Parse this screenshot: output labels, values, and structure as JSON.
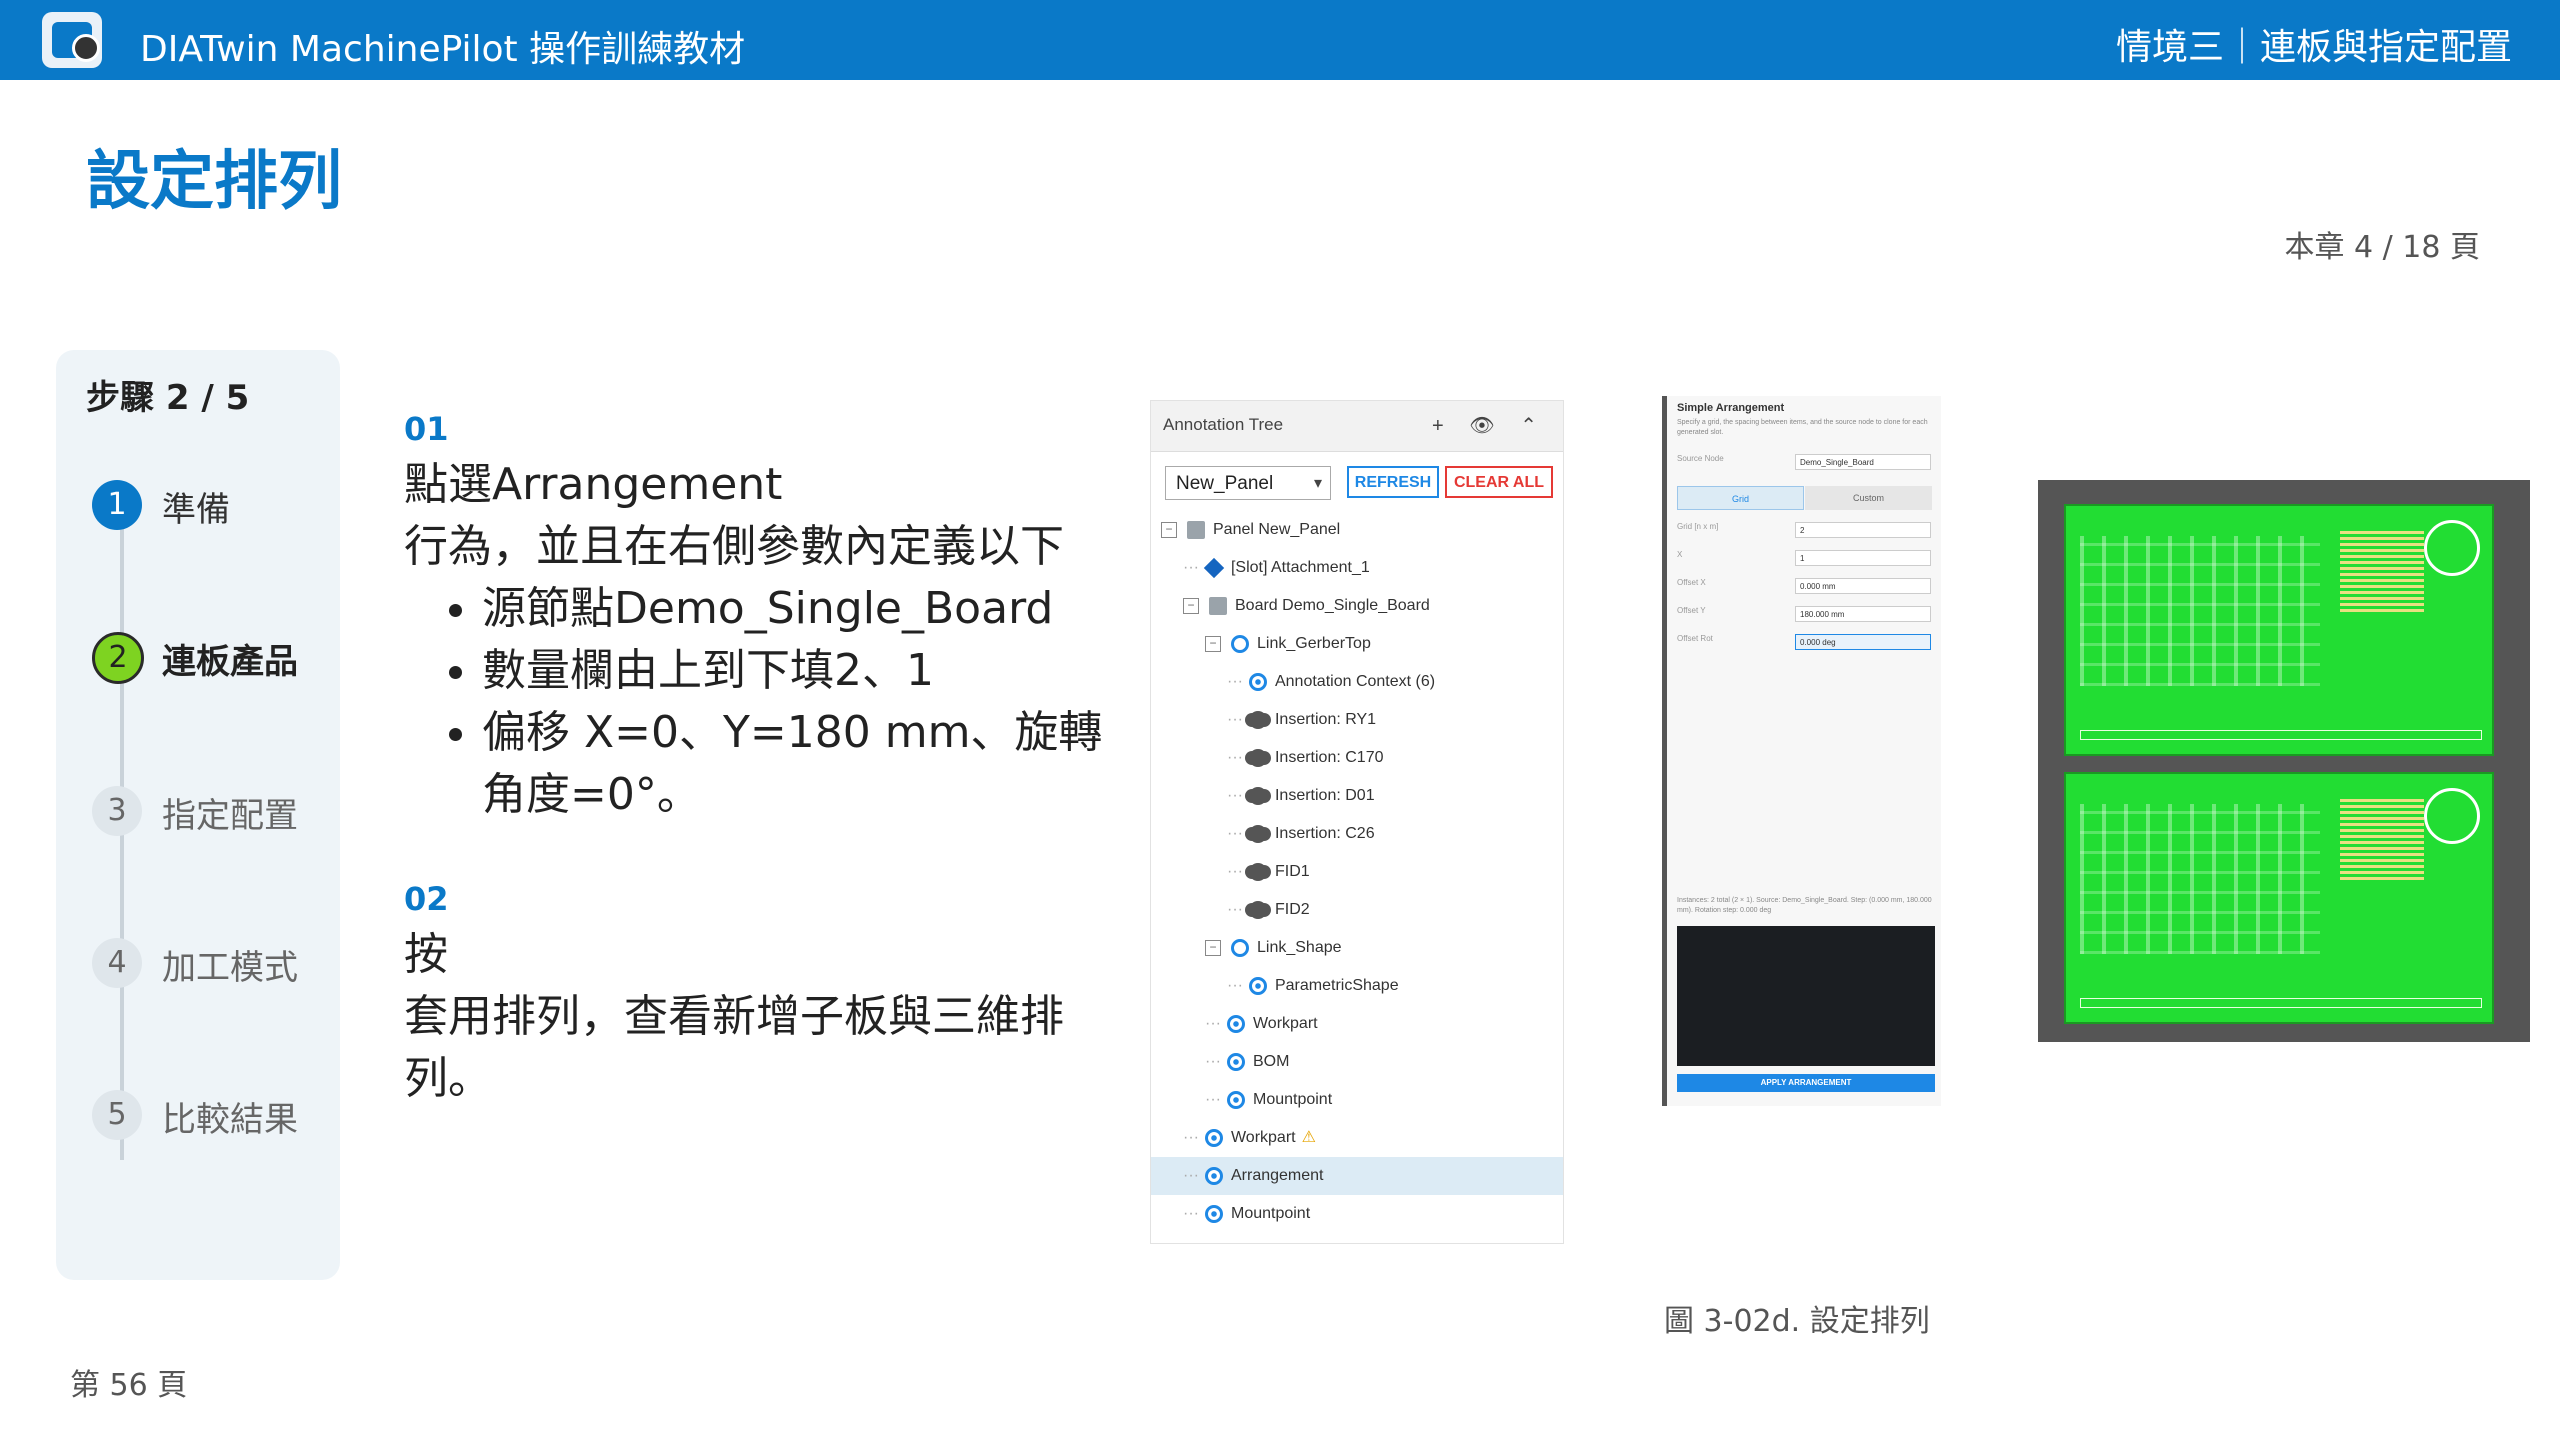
{
  "header": {
    "app_title": "DIATwin MachinePilot 操作訓練教材",
    "section_title": "情境三｜連板與指定配置"
  },
  "page_title": "設定排列",
  "chapter_page": "本章 4 / 18 頁",
  "stepper": {
    "count_label": "步驟 2 / 5",
    "steps": [
      {
        "num": "1",
        "label": "準備"
      },
      {
        "num": "2",
        "label": "連板產品"
      },
      {
        "num": "3",
        "label": "指定配置"
      },
      {
        "num": "4",
        "label": "加工模式"
      },
      {
        "num": "5",
        "label": "比較結果"
      }
    ]
  },
  "content": {
    "step1_num": "01",
    "step1_line1": "點選Arrangement",
    "step1_line2": "行為，並且在右側參數內定義以下",
    "step1_bullets": [
      "源節點Demo_Single_Board",
      "數量欄由上到下填2、1",
      "偏移 X=0、Y=180 mm、旋轉角度=0°。"
    ],
    "step2_num": "02",
    "step2_line1": "按",
    "step2_line2": "套用排列，查看新增子板與三維排列。"
  },
  "annotation_tree": {
    "title": "Annotation Tree",
    "header_icons": "+ 👁 ⌃",
    "panel_select": "New_Panel",
    "refresh_label": "REFRESH",
    "clear_label": "CLEAR ALL",
    "rows": [
      {
        "text": "Panel  New_Panel",
        "indent": 0,
        "icon": "folder",
        "toggle": "⊟"
      },
      {
        "text": "[Slot] Attachment_1",
        "indent": 1,
        "icon": "cube",
        "toggle": ""
      },
      {
        "text": "Board  Demo_Single_Board",
        "indent": 1,
        "icon": "folder",
        "toggle": "⊟"
      },
      {
        "text": "Link_GerberTop",
        "indent": 2,
        "icon": "link",
        "toggle": "⊟"
      },
      {
        "text": "Annotation Context (6)",
        "indent": 3,
        "icon": "target",
        "toggle": ""
      },
      {
        "text": "Insertion: RY1",
        "indent": 3,
        "icon": "gear",
        "toggle": ""
      },
      {
        "text": "Insertion: C170",
        "indent": 3,
        "icon": "gear",
        "toggle": ""
      },
      {
        "text": "Insertion: D01",
        "indent": 3,
        "icon": "gear",
        "toggle": ""
      },
      {
        "text": "Insertion: C26",
        "indent": 3,
        "icon": "gear",
        "toggle": ""
      },
      {
        "text": "FID1",
        "indent": 3,
        "icon": "gear",
        "toggle": ""
      },
      {
        "text": "FID2",
        "indent": 3,
        "icon": "gear",
        "toggle": ""
      },
      {
        "text": "Link_Shape",
        "indent": 2,
        "icon": "link",
        "toggle": "⊟"
      },
      {
        "text": "ParametricShape",
        "indent": 3,
        "icon": "target",
        "toggle": ""
      },
      {
        "text": "Workpart",
        "indent": 2,
        "icon": "target",
        "toggle": ""
      },
      {
        "text": "BOM",
        "indent": 2,
        "icon": "target",
        "toggle": ""
      },
      {
        "text": "Mountpoint",
        "indent": 2,
        "icon": "target",
        "toggle": ""
      },
      {
        "text": "Workpart",
        "indent": 1,
        "icon": "target",
        "toggle": "",
        "warn": "⚠"
      },
      {
        "text": "Arrangement",
        "indent": 1,
        "icon": "target",
        "toggle": "",
        "selected": true
      },
      {
        "text": "Mountpoint",
        "indent": 1,
        "icon": "target",
        "toggle": ""
      }
    ]
  },
  "arrangement_panel": {
    "title": "Simple Arrangement",
    "subtitle": "Specify a grid, the spacing between items, and the source node to clone for each generated slot.",
    "source_label": "Source Node",
    "source_value": "Demo_Single_Board",
    "tab_grid": "Grid",
    "tab_custom": "Custom",
    "fields": [
      {
        "label": "Grid [n x m]",
        "value": "2"
      },
      {
        "label": "X",
        "value": "1"
      },
      {
        "label": "Offset X",
        "value": "0.000 mm"
      },
      {
        "label": "Offset Y",
        "value": "180.000 mm"
      },
      {
        "label": "Offset Rot",
        "value": "0.000 deg"
      }
    ],
    "note": "Instances: 2 total (2 × 1). Source: Demo_Single_Board. Step: (0.000 mm, 180.000 mm). Rotation step: 0.000 deg",
    "apply_label": "APPLY ARRANGEMENT"
  },
  "figure_caption": "圖 3-02d. 設定排列",
  "footer_page": "第 56 頁"
}
